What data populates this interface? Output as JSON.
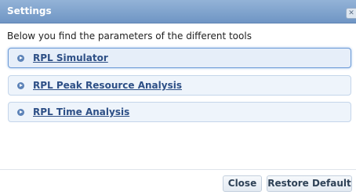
{
  "dialog": {
    "title": "Settings",
    "close_icon": "close-icon",
    "close_glyph": "✕",
    "intro": "Below you find the parameters of the different tools"
  },
  "accordion": {
    "items": [
      {
        "label": "RPL Simulator",
        "active": true
      },
      {
        "label": "RPL Peak Resource Analysis",
        "active": false
      },
      {
        "label": "RPL Time Analysis",
        "active": false
      }
    ]
  },
  "buttons": {
    "close": "Close",
    "restore_default": "Restore Default"
  }
}
